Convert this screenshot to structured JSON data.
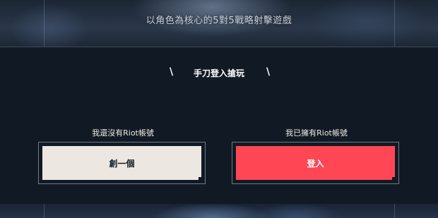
{
  "hero": {
    "tagline": "以角色為核心的5對5戰略射擊遊戲"
  },
  "panel": {
    "title": "手刀登入搶玩",
    "slash_left": "\\",
    "slash_right": "\\"
  },
  "signup": {
    "label": "我還沒有Riot帳號",
    "button_label": "創一個"
  },
  "signin": {
    "label": "我已擁有Riot帳號",
    "button_label": "登入"
  },
  "colors": {
    "background": "#0f1923",
    "accent_red": "#ff4655",
    "light_button": "#ece8e1"
  }
}
